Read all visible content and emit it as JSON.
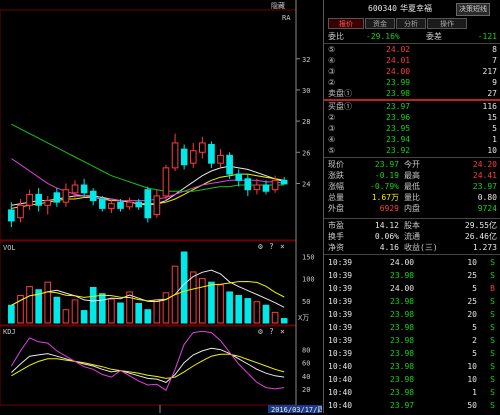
{
  "header": {
    "stock_code": "600340",
    "stock_name": "华夏幸福",
    "back_button": "决策短线",
    "left_button": "隐藏"
  },
  "tabs": [
    {
      "label": "报价",
      "active": true
    },
    {
      "label": "资金",
      "active": false
    },
    {
      "label": "分析",
      "active": false
    },
    {
      "label": "操作",
      "active": false
    }
  ],
  "order_book": {
    "weibi_label": "委比",
    "weibi_value": "-29.16%",
    "weicha_label": "委差",
    "weicha_value": "-121",
    "sell": [
      {
        "label": "⑤",
        "price": "24.02",
        "vol": "8"
      },
      {
        "label": "④",
        "price": "24.01",
        "vol": "7"
      },
      {
        "label": "③",
        "price": "24.00",
        "vol": "217"
      },
      {
        "label": "②",
        "price": "23.99",
        "vol": "9"
      },
      {
        "label": "卖盘①",
        "price": "23.98",
        "vol": "27"
      }
    ],
    "buy": [
      {
        "label": "买盘①",
        "price": "23.97",
        "vol": "116"
      },
      {
        "label": "②",
        "price": "23.96",
        "vol": "15"
      },
      {
        "label": "③",
        "price": "23.95",
        "vol": "5"
      },
      {
        "label": "④",
        "price": "23.94",
        "vol": "1"
      },
      {
        "label": "⑤",
        "price": "23.92",
        "vol": "10"
      }
    ]
  },
  "quote": {
    "rows": [
      {
        "l1": "现价",
        "v1": "23.97",
        "l2": "今开",
        "v2": "24.20"
      },
      {
        "l1": "涨跌",
        "v1": "-0.19",
        "l2": "最高",
        "v2": "24.41"
      },
      {
        "l1": "涨幅",
        "v1": "-0.79%",
        "l2": "最低",
        "v2": "23.97"
      },
      {
        "l1": "总量",
        "v1": "1.67万",
        "l2": "量比",
        "v2": "0.80"
      },
      {
        "l1": "外盘",
        "v1": "6929",
        "l2": "内盘",
        "v2": "9724"
      }
    ],
    "rows2": [
      {
        "l1": "市盈",
        "v1": "14.12",
        "l2": "股本",
        "v2": "29.55亿"
      },
      {
        "l1": "换手",
        "v1": "0.06%",
        "l2": "流通",
        "v2": "26.46亿"
      },
      {
        "l1": "净资",
        "v1": "4.16",
        "l2": "收益(三)",
        "v2": "1.273"
      }
    ]
  },
  "ticks": [
    {
      "time": "10:39",
      "price": "24.00",
      "vol": "10",
      "side": "S"
    },
    {
      "time": "10:39",
      "price": "23.98",
      "vol": "25",
      "side": "S"
    },
    {
      "time": "10:39",
      "price": "24.00",
      "vol": "5",
      "side": "B"
    },
    {
      "time": "10:39",
      "price": "23.98",
      "vol": "25",
      "side": "S"
    },
    {
      "time": "10:39",
      "price": "23.98",
      "vol": "20",
      "side": "S"
    },
    {
      "time": "10:39",
      "price": "23.98",
      "vol": "5",
      "side": "S"
    },
    {
      "time": "10:39",
      "price": "23.98",
      "vol": "2",
      "side": "S"
    },
    {
      "time": "10:39",
      "price": "23.98",
      "vol": "5",
      "side": "S"
    },
    {
      "time": "10:40",
      "price": "23.98",
      "vol": "10",
      "side": "S"
    },
    {
      "time": "10:40",
      "price": "23.98",
      "vol": "10",
      "side": "S"
    },
    {
      "time": "10:40",
      "price": "23.98",
      "vol": "1",
      "side": "S"
    },
    {
      "time": "10:40",
      "price": "23.97",
      "vol": "50",
      "side": "S"
    }
  ],
  "chart": {
    "top_right_label": "RA",
    "price_axis": [
      "32",
      "30",
      "28",
      "26",
      "24"
    ],
    "vol_label": "VOL",
    "vol_axis": [
      "150",
      "100",
      "50"
    ],
    "vol_unit": "X万",
    "kdj_label": "KDJ",
    "kdj_axis": [
      "80",
      "60",
      "40",
      "20"
    ],
    "date_label": "2016/03/17/四",
    "panel_icons": [
      "gear-icon",
      "help-icon",
      "close-icon"
    ]
  },
  "chart_data": [
    {
      "type": "candlestick",
      "title": "",
      "ylim": [
        20.5,
        35
      ],
      "candles": [
        {
          "o": 22.3,
          "c": 21.6,
          "h": 22.8,
          "l": 21.2
        },
        {
          "o": 21.8,
          "c": 22.6,
          "h": 23.0,
          "l": 21.5
        },
        {
          "o": 22.6,
          "c": 23.3,
          "h": 23.6,
          "l": 22.3
        },
        {
          "o": 23.3,
          "c": 22.6,
          "h": 23.7,
          "l": 22.2
        },
        {
          "o": 22.6,
          "c": 22.9,
          "h": 23.2,
          "l": 22.0
        },
        {
          "o": 23.4,
          "c": 22.8,
          "h": 23.7,
          "l": 22.5
        },
        {
          "o": 22.8,
          "c": 23.6,
          "h": 24.0,
          "l": 22.5
        },
        {
          "o": 23.4,
          "c": 23.9,
          "h": 24.2,
          "l": 23.0
        },
        {
          "o": 23.9,
          "c": 23.4,
          "h": 24.3,
          "l": 23.1
        },
        {
          "o": 23.5,
          "c": 22.9,
          "h": 23.7,
          "l": 22.6
        },
        {
          "o": 23.0,
          "c": 22.4,
          "h": 23.2,
          "l": 22.2
        },
        {
          "o": 22.4,
          "c": 22.7,
          "h": 23.0,
          "l": 22.1
        },
        {
          "o": 22.8,
          "c": 22.4,
          "h": 23.0,
          "l": 22.2
        },
        {
          "o": 22.5,
          "c": 22.8,
          "h": 23.1,
          "l": 22.3
        },
        {
          "o": 22.8,
          "c": 22.5,
          "h": 23.0,
          "l": 22.3
        },
        {
          "o": 23.6,
          "c": 21.8,
          "h": 23.8,
          "l": 21.5
        },
        {
          "o": 22.0,
          "c": 23.2,
          "h": 23.6,
          "l": 21.8
        },
        {
          "o": 23.2,
          "c": 25.0,
          "h": 25.2,
          "l": 22.9
        },
        {
          "o": 25.0,
          "c": 26.6,
          "h": 27.2,
          "l": 24.8
        },
        {
          "o": 26.2,
          "c": 25.2,
          "h": 26.5,
          "l": 24.9
        },
        {
          "o": 25.3,
          "c": 26.1,
          "h": 26.6,
          "l": 25.0
        },
        {
          "o": 26.0,
          "c": 26.6,
          "h": 27.0,
          "l": 25.6
        },
        {
          "o": 26.5,
          "c": 25.3,
          "h": 26.7,
          "l": 25.0
        },
        {
          "o": 25.3,
          "c": 25.8,
          "h": 26.2,
          "l": 25.0
        },
        {
          "o": 25.8,
          "c": 24.6,
          "h": 26.0,
          "l": 24.3
        },
        {
          "o": 24.6,
          "c": 24.2,
          "h": 24.9,
          "l": 23.8
        },
        {
          "o": 24.3,
          "c": 23.6,
          "h": 24.6,
          "l": 23.2
        },
        {
          "o": 23.6,
          "c": 23.9,
          "h": 24.3,
          "l": 23.3
        },
        {
          "o": 23.9,
          "c": 23.5,
          "h": 24.2,
          "l": 23.3
        },
        {
          "o": 23.6,
          "c": 24.2,
          "h": 24.5,
          "l": 23.4
        },
        {
          "o": 24.2,
          "c": 23.97,
          "h": 24.41,
          "l": 23.97
        }
      ],
      "ma_lines": [
        {
          "color": "#e8e8e8",
          "values": [
            22.6,
            22.7,
            22.8,
            22.9,
            22.9,
            23.0,
            23.1,
            23.2,
            23.2,
            23.2,
            23.1,
            23.0,
            22.9,
            22.8,
            22.7,
            22.6,
            22.7,
            22.9,
            23.3,
            23.7,
            24.1,
            24.5,
            24.8,
            25.0,
            25.1,
            25.0,
            24.9,
            24.7,
            24.5,
            24.3,
            24.1
          ]
        },
        {
          "color": "#f0f000",
          "values": [
            22.4,
            22.5,
            22.6,
            22.7,
            22.8,
            22.9,
            23.0,
            23.0,
            23.1,
            23.1,
            23.0,
            22.9,
            22.9,
            22.8,
            22.7,
            22.7,
            22.7,
            22.8,
            23.0,
            23.3,
            23.6,
            23.9,
            24.2,
            24.4,
            24.5,
            24.6,
            24.6,
            24.5,
            24.4,
            24.3,
            24.2
          ]
        },
        {
          "color": "#e040e0",
          "values": [
            25.6,
            25.2,
            24.8,
            24.4,
            24.0,
            23.7,
            23.5,
            23.3,
            23.2,
            23.1,
            23.0,
            23.0,
            22.9,
            22.9,
            22.9,
            22.9,
            23.0,
            23.1,
            23.3,
            23.5,
            23.7,
            23.9,
            24.0,
            24.1,
            24.2,
            24.2,
            24.2,
            24.2,
            24.1,
            24.1,
            24.0
          ]
        },
        {
          "color": "#18c018",
          "values": [
            27.8,
            27.5,
            27.2,
            26.9,
            26.6,
            26.3,
            26.0,
            25.7,
            25.4,
            25.1,
            24.8,
            24.5,
            24.3,
            24.1,
            23.9,
            23.7,
            23.6,
            23.5,
            23.5,
            23.5,
            23.5,
            23.6,
            23.7,
            23.8,
            23.8,
            23.9,
            23.9,
            23.9,
            23.9,
            23.9,
            23.9
          ]
        }
      ]
    },
    {
      "type": "bar",
      "title": "VOL",
      "ylim": [
        0,
        160
      ],
      "values": [
        40,
        62,
        82,
        75,
        92,
        58,
        30,
        52,
        28,
        80,
        66,
        54,
        45,
        70,
        44,
        30,
        52,
        68,
        128,
        160,
        115,
        100,
        92,
        86,
        70,
        62,
        55,
        48,
        40,
        24,
        10
      ],
      "colors_up": [
        false,
        true,
        true,
        false,
        true,
        false,
        true,
        true,
        false,
        false,
        false,
        true,
        false,
        true,
        false,
        false,
        true,
        true,
        true,
        false,
        true,
        true,
        false,
        true,
        false,
        false,
        false,
        true,
        false,
        true,
        false
      ]
    },
    {
      "type": "line",
      "title": "KDJ",
      "ylim": [
        0,
        100
      ],
      "series": [
        {
          "color": "#e8e8e8",
          "values": [
            45,
            58,
            70,
            72,
            74,
            70,
            66,
            62,
            58,
            55,
            50,
            46,
            48,
            44,
            40,
            36,
            35,
            30,
            42,
            60,
            72,
            78,
            82,
            80,
            74,
            66,
            58,
            50,
            44,
            40,
            38
          ]
        },
        {
          "color": "#f0f000",
          "values": [
            40,
            48,
            56,
            62,
            66,
            66,
            64,
            62,
            60,
            57,
            54,
            50,
            48,
            46,
            44,
            41,
            39,
            36,
            38,
            46,
            55,
            63,
            70,
            73,
            73,
            70,
            65,
            60,
            55,
            50,
            46
          ]
        },
        {
          "color": "#e040e0",
          "values": [
            55,
            78,
            98,
            92,
            90,
            78,
            70,
            62,
            54,
            50,
            42,
            38,
            48,
            40,
            32,
            26,
            27,
            18,
            50,
            88,
            106,
            108,
            106,
            94,
            76,
            58,
            44,
            30,
            22,
            20,
            22
          ]
        }
      ]
    }
  ]
}
